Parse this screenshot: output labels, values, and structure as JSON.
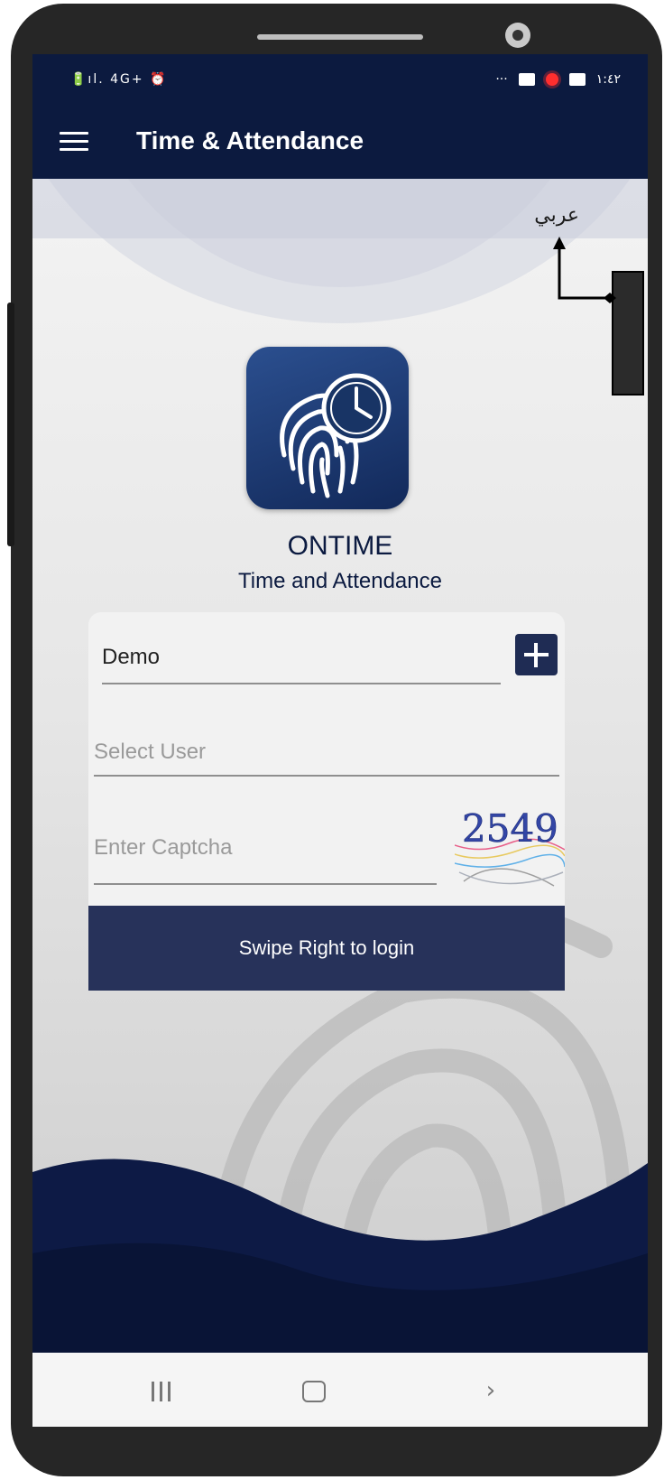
{
  "status_bar": {
    "left_icons": "🔋ıl. 4G+ ⏰",
    "time": "١:٤٢",
    "more": "···"
  },
  "app_bar": {
    "title": "Time & Attendance"
  },
  "language_toggle": "عربي",
  "brand": {
    "name": "ONTIME",
    "tagline": "Time and Attendance"
  },
  "login_form": {
    "company_value": "Demo",
    "user_placeholder": "Select User",
    "captcha_placeholder": "Enter Captcha",
    "captcha_code": "2549",
    "swipe_label": "Swipe Right to login"
  },
  "nav_bar": {
    "back_glyph": "›"
  },
  "colors": {
    "primary": "#0c1a3f",
    "button": "#27325a",
    "add": "#1f2c54"
  },
  "icons": [
    "menu-icon",
    "fingerprint-clock-icon",
    "plus-icon",
    "recents-icon",
    "home-icon",
    "back-icon"
  ]
}
